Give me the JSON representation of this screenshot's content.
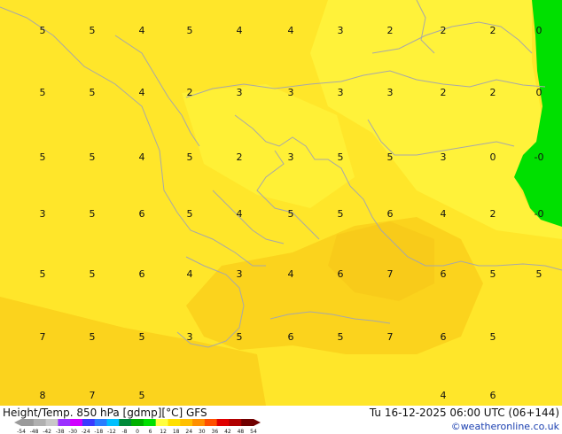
{
  "footer": {
    "title": "Height/Temp. 850 hPa [gdmp][°C] GFS",
    "valid_time": "Tu 16-12-2025 06:00 UTC (06+144)",
    "credit": "©weatheronline.co.uk"
  },
  "colorbar": {
    "ticks": [
      "-54",
      "-48",
      "-42",
      "-38",
      "-30",
      "-24",
      "-18",
      "-12",
      "-8",
      "0",
      "6",
      "12",
      "18",
      "24",
      "30",
      "36",
      "42",
      "48",
      "54"
    ],
    "colors": [
      "#9a9a9a",
      "#b0b0b0",
      "#c8c8c8",
      "#9b30ff",
      "#d000ff",
      "#3a3aff",
      "#2a7dff",
      "#00c0ff",
      "#008a3a",
      "#00b000",
      "#00e000",
      "#ffff40",
      "#ffe000",
      "#ffc000",
      "#ff9000",
      "#ff5000",
      "#e00000",
      "#b00000",
      "#700000"
    ]
  },
  "colors": {
    "land_main": "#ffe62a",
    "warm_zone": "#fbd31d",
    "cool_zone": "#fff23a",
    "green_zone": "#00e000",
    "coastline": "#a8a8a8"
  },
  "map_values": [
    {
      "label": "5",
      "lon_col": 1,
      "lat_row": 1
    },
    {
      "label": "5",
      "lon_col": 2,
      "lat_row": 1
    },
    {
      "label": "4",
      "lon_col": 3,
      "lat_row": 1
    },
    {
      "label": "5",
      "lon_col": 4,
      "lat_row": 1
    },
    {
      "label": "4",
      "lon_col": 5,
      "lat_row": 1
    },
    {
      "label": "4",
      "lon_col": 6,
      "lat_row": 1
    },
    {
      "label": "3",
      "lon_col": 7,
      "lat_row": 1
    },
    {
      "label": "2",
      "lon_col": 8,
      "lat_row": 1
    },
    {
      "label": "2",
      "lon_col": 9,
      "lat_row": 1
    },
    {
      "label": "2",
      "lon_col": 10,
      "lat_row": 1
    },
    {
      "label": "0",
      "lon_col": 11,
      "lat_row": 1
    },
    {
      "label": "5",
      "lon_col": 1,
      "lat_row": 2
    },
    {
      "label": "5",
      "lon_col": 2,
      "lat_row": 2
    },
    {
      "label": "4",
      "lon_col": 3,
      "lat_row": 2
    },
    {
      "label": "2",
      "lon_col": 4,
      "lat_row": 2
    },
    {
      "label": "3",
      "lon_col": 5,
      "lat_row": 2
    },
    {
      "label": "3",
      "lon_col": 6,
      "lat_row": 2
    },
    {
      "label": "3",
      "lon_col": 7,
      "lat_row": 2
    },
    {
      "label": "3",
      "lon_col": 8,
      "lat_row": 2
    },
    {
      "label": "2",
      "lon_col": 9,
      "lat_row": 2
    },
    {
      "label": "2",
      "lon_col": 10,
      "lat_row": 2
    },
    {
      "label": "0",
      "lon_col": 11,
      "lat_row": 2
    },
    {
      "label": "5",
      "lon_col": 1,
      "lat_row": 3
    },
    {
      "label": "5",
      "lon_col": 2,
      "lat_row": 3
    },
    {
      "label": "4",
      "lon_col": 3,
      "lat_row": 3
    },
    {
      "label": "5",
      "lon_col": 4,
      "lat_row": 3
    },
    {
      "label": "2",
      "lon_col": 5,
      "lat_row": 3
    },
    {
      "label": "3",
      "lon_col": 6,
      "lat_row": 3
    },
    {
      "label": "5",
      "lon_col": 7,
      "lat_row": 3
    },
    {
      "label": "5",
      "lon_col": 8,
      "lat_row": 3
    },
    {
      "label": "3",
      "lon_col": 9,
      "lat_row": 3
    },
    {
      "label": "0",
      "lon_col": 10,
      "lat_row": 3
    },
    {
      "label": "-0",
      "lon_col": 11,
      "lat_row": 3
    },
    {
      "label": "3",
      "lon_col": 1,
      "lat_row": 4
    },
    {
      "label": "5",
      "lon_col": 2,
      "lat_row": 4
    },
    {
      "label": "6",
      "lon_col": 3,
      "lat_row": 4
    },
    {
      "label": "5",
      "lon_col": 4,
      "lat_row": 4
    },
    {
      "label": "4",
      "lon_col": 5,
      "lat_row": 4
    },
    {
      "label": "5",
      "lon_col": 6,
      "lat_row": 4
    },
    {
      "label": "5",
      "lon_col": 7,
      "lat_row": 4
    },
    {
      "label": "6",
      "lon_col": 8,
      "lat_row": 4
    },
    {
      "label": "4",
      "lon_col": 9,
      "lat_row": 4
    },
    {
      "label": "2",
      "lon_col": 10,
      "lat_row": 4
    },
    {
      "label": "-0",
      "lon_col": 11,
      "lat_row": 4
    },
    {
      "label": "5",
      "lon_col": 1,
      "lat_row": 5
    },
    {
      "label": "5",
      "lon_col": 2,
      "lat_row": 5
    },
    {
      "label": "6",
      "lon_col": 3,
      "lat_row": 5
    },
    {
      "label": "4",
      "lon_col": 4,
      "lat_row": 5
    },
    {
      "label": "3",
      "lon_col": 5,
      "lat_row": 5
    },
    {
      "label": "4",
      "lon_col": 6,
      "lat_row": 5
    },
    {
      "label": "6",
      "lon_col": 7,
      "lat_row": 5
    },
    {
      "label": "7",
      "lon_col": 8,
      "lat_row": 5
    },
    {
      "label": "6",
      "lon_col": 9,
      "lat_row": 5
    },
    {
      "label": "5",
      "lon_col": 10,
      "lat_row": 5
    },
    {
      "label": "5",
      "lon_col": 11,
      "lat_row": 5
    },
    {
      "label": "7",
      "lon_col": 1,
      "lat_row": 6
    },
    {
      "label": "5",
      "lon_col": 2,
      "lat_row": 6
    },
    {
      "label": "5",
      "lon_col": 3,
      "lat_row": 6
    },
    {
      "label": "3",
      "lon_col": 4,
      "lat_row": 6
    },
    {
      "label": "5",
      "lon_col": 5,
      "lat_row": 6
    },
    {
      "label": "6",
      "lon_col": 6,
      "lat_row": 6
    },
    {
      "label": "5",
      "lon_col": 7,
      "lat_row": 6
    },
    {
      "label": "7",
      "lon_col": 8,
      "lat_row": 6
    },
    {
      "label": "6",
      "lon_col": 9,
      "lat_row": 6
    },
    {
      "label": "5",
      "lon_col": 10,
      "lat_row": 6
    },
    {
      "label": "8",
      "lon_col": 1,
      "lat_row": 7
    },
    {
      "label": "7",
      "lon_col": 2,
      "lat_row": 7
    },
    {
      "label": "5",
      "lon_col": 3,
      "lat_row": 7
    },
    {
      "label": "4",
      "lon_col": 9,
      "lat_row": 7
    },
    {
      "label": "6",
      "lon_col": 10,
      "lat_row": 7
    }
  ]
}
